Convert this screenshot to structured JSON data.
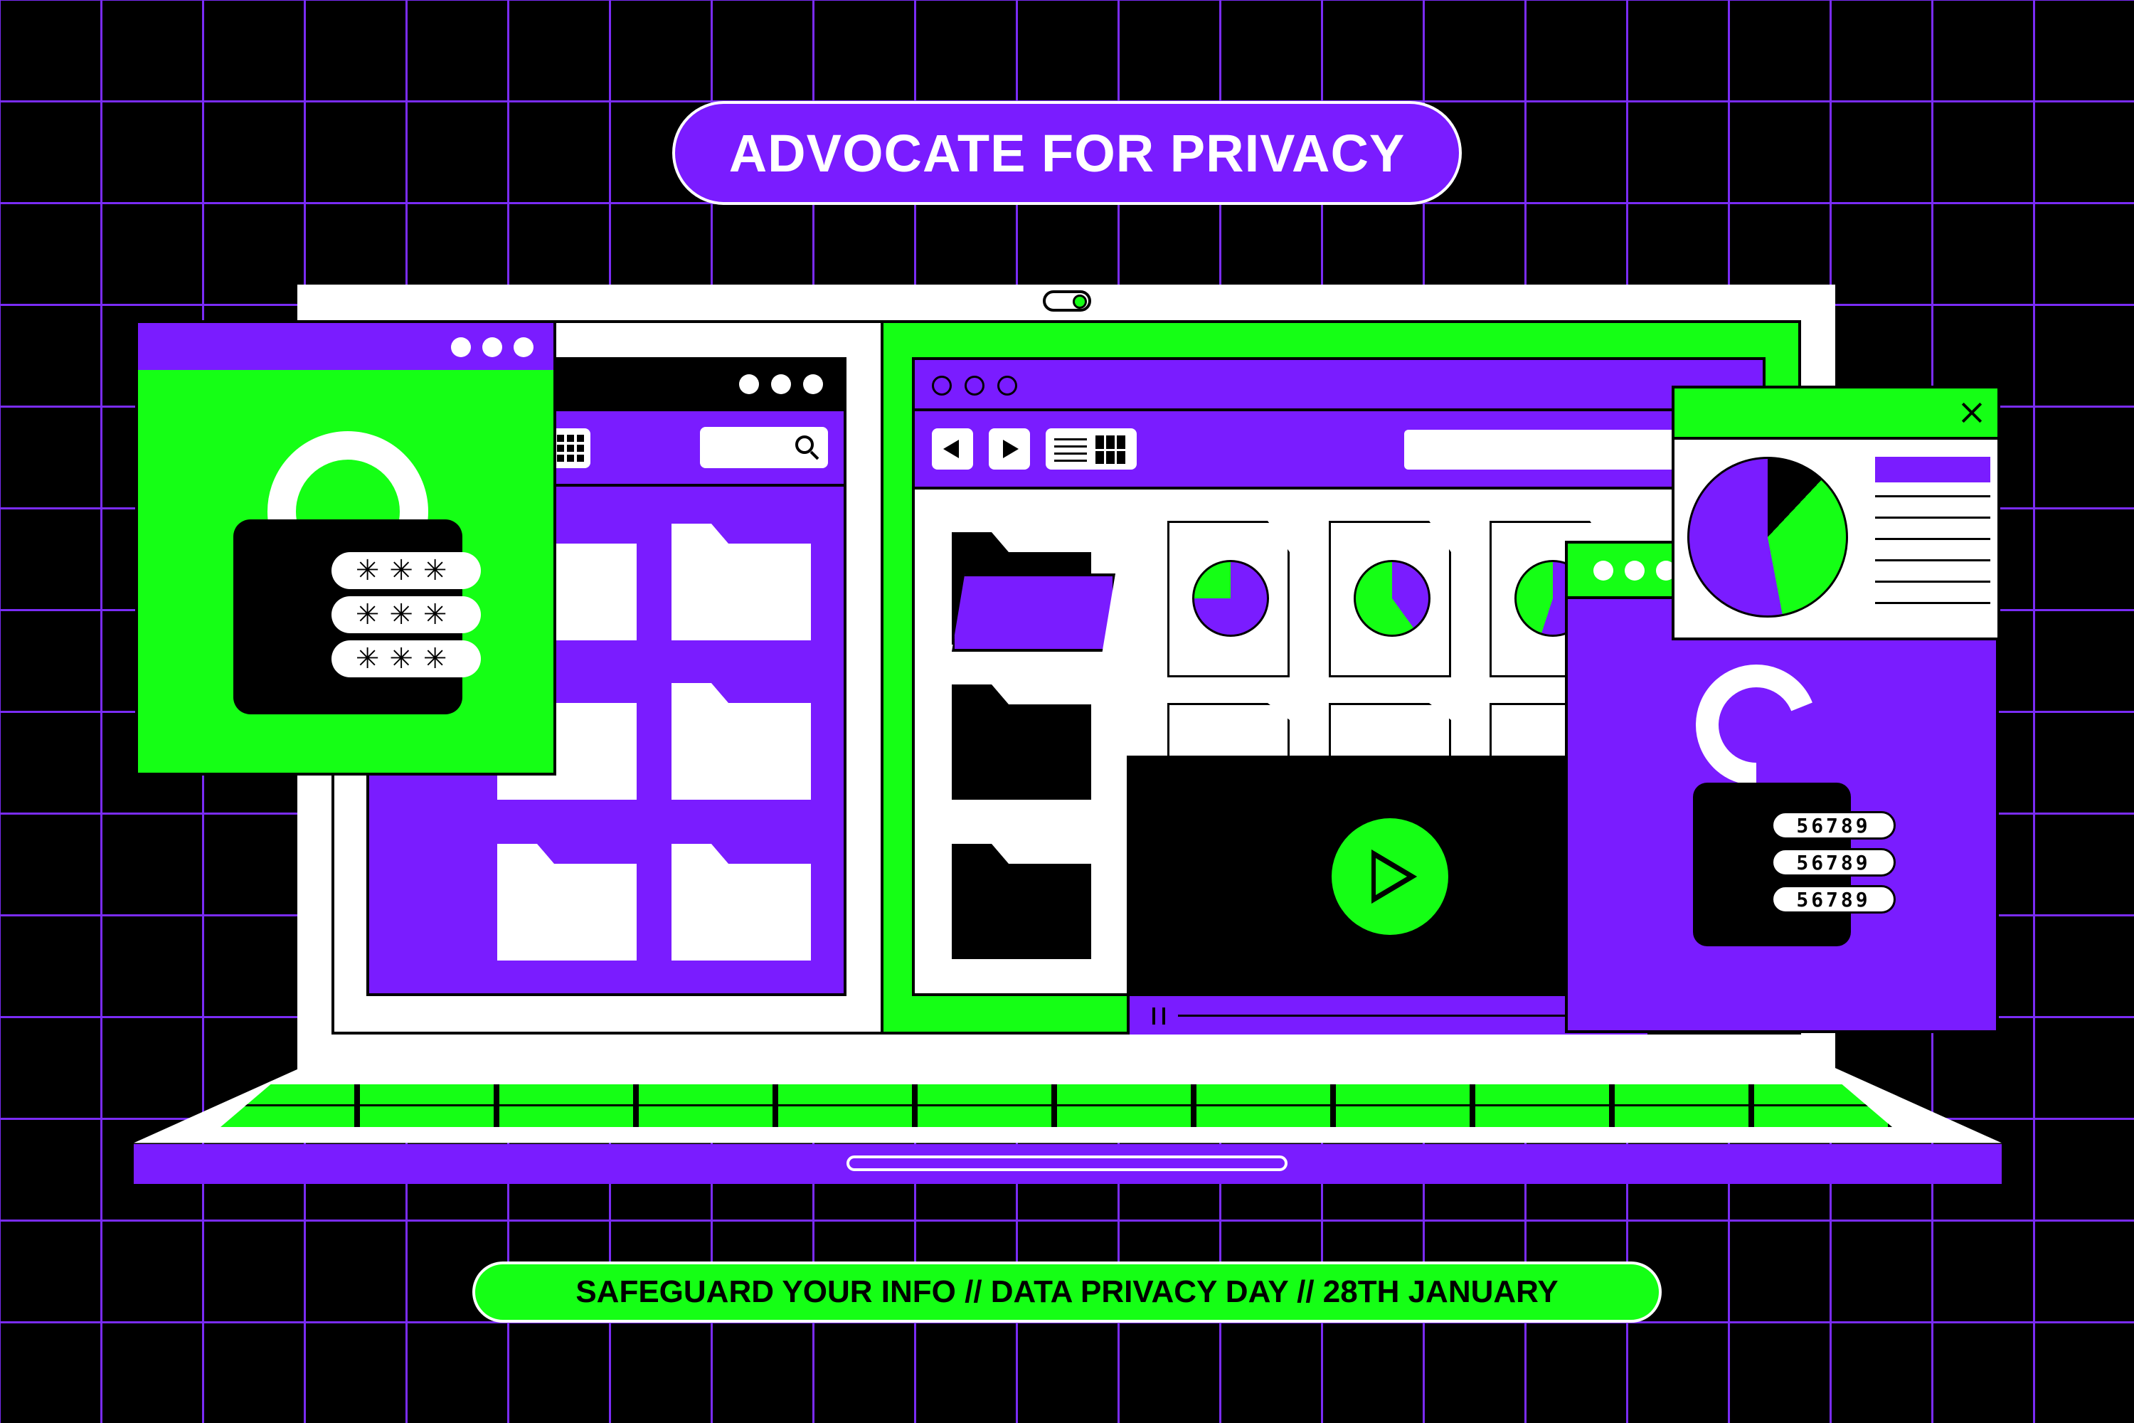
{
  "header": {
    "title": "ADVOCATE FOR PRIVACY"
  },
  "footer": {
    "tagline": "SAFEGUARD YOUR INFO // DATA PRIVACY DAY // 28TH JANUARY"
  },
  "lock_window": {
    "password_masks": [
      "✳✳✳",
      "✳✳✳",
      "✳✳✳"
    ]
  },
  "code_window": {
    "codes": [
      "56789",
      "56789",
      "56789"
    ]
  },
  "colors": {
    "purple": "#7a1cff",
    "green": "#15ff15",
    "black": "#000000",
    "white": "#ffffff"
  },
  "icons": [
    "search-icon",
    "grid-view-icon",
    "list-view-icon",
    "back-arrow-icon",
    "forward-arrow-icon",
    "close-icon",
    "play-icon",
    "pause-icon",
    "padlock-icon",
    "pie-chart-icon",
    "folder-icon",
    "document-icon",
    "toggle-icon",
    "touchpad-icon"
  ]
}
